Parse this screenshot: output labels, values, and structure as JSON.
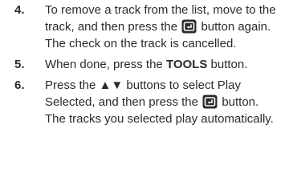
{
  "steps": [
    {
      "number": "4.",
      "line_a": "To remove a track from the list, move to the track, and then press the",
      "line_b": "button again.",
      "result": "The check on the track is cancelled.",
      "icon": "enter-button-icon"
    },
    {
      "number": "5.",
      "line_a": "When done, press the",
      "bold": "TOOLS",
      "line_b": "button."
    },
    {
      "number": "6.",
      "line_a": "Press the ▲▼ buttons to select Play Selected, and then press the",
      "line_b": "button.",
      "result": "The tracks you selected play automatically.",
      "icon": "enter-button-icon"
    }
  ],
  "colors": {
    "text": "#2b2b2b",
    "icon_fill": "#2b2b2b"
  }
}
